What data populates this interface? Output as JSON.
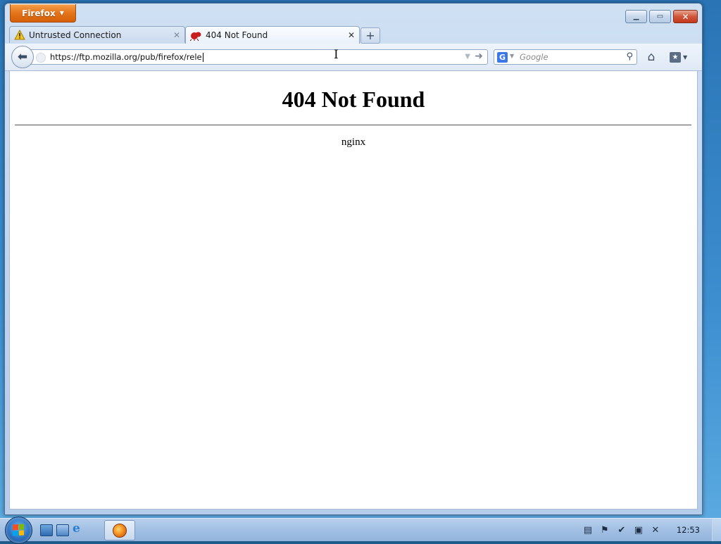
{
  "app": {
    "menu_button": "Firefox",
    "caption": {
      "minimize": "▁",
      "restore": "▭",
      "close": "✕"
    }
  },
  "tabs": [
    {
      "label": "Untrusted Connection",
      "icon": "warning-icon",
      "active": false
    },
    {
      "label": "404 Not Found",
      "icon": "ant-favicon-icon",
      "active": true
    }
  ],
  "new_tab": "+",
  "navbar": {
    "url": "https://ftp.mozilla.org/pub/firefox/rele",
    "search_placeholder": "Google",
    "search_engine": "G"
  },
  "page": {
    "heading": "404 Not Found",
    "server": "nginx"
  },
  "taskbar": {
    "clock": "12:53"
  },
  "colors": {
    "firefox_orange": "#e4741b",
    "close_red": "#c2381d",
    "taskbar_blue": "#a4c1e4"
  }
}
